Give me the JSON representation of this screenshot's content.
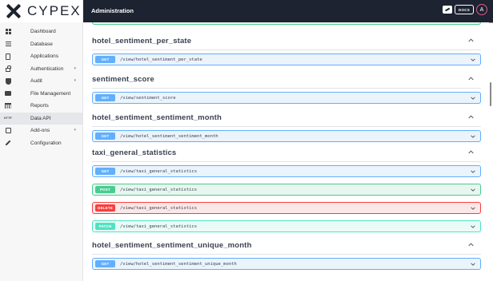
{
  "app": {
    "logo_text": "CYPEX",
    "title": "Administration",
    "docs_label": "DOCS",
    "avatar_initial": "A"
  },
  "sidebar": {
    "items": [
      {
        "label": "Dashboard",
        "icon": "dashboard-icon"
      },
      {
        "label": "Database",
        "icon": "database-icon"
      },
      {
        "label": "Applications",
        "icon": "applications-icon"
      },
      {
        "label": "Authentication",
        "icon": "lock-icon",
        "expandable": true
      },
      {
        "label": "Audit",
        "icon": "shield-icon",
        "expandable": true
      },
      {
        "label": "File Management",
        "icon": "folder-icon"
      },
      {
        "label": "Reports",
        "icon": "table-icon"
      },
      {
        "label": "Data API",
        "icon": "http-icon",
        "active": true,
        "icon_text": "HTTP"
      },
      {
        "label": "Add-ons",
        "icon": "puzzle-icon",
        "expandable": true
      },
      {
        "label": "Configuration",
        "icon": "wrench-icon"
      }
    ]
  },
  "sections": [
    {
      "title": "hotel_sentiment_per_state",
      "operations": [
        {
          "method": "GET",
          "path": "/view/hotel_sentiment_per_state"
        }
      ]
    },
    {
      "title": "sentiment_score",
      "operations": [
        {
          "method": "GET",
          "path": "/view/sentiment_score"
        }
      ]
    },
    {
      "title": "hotel_sentiment_sentiment_month",
      "operations": [
        {
          "method": "GET",
          "path": "/view/hotel_sentiment_sentiment_month"
        }
      ]
    },
    {
      "title": "taxi_general_statistics",
      "operations": [
        {
          "method": "GET",
          "path": "/view/taxi_general_statistics"
        },
        {
          "method": "POST",
          "path": "/view/taxi_general_statistics"
        },
        {
          "method": "DELETE",
          "path": "/view/taxi_general_statistics"
        },
        {
          "method": "PATCH",
          "path": "/view/taxi_general_statistics"
        }
      ]
    },
    {
      "title": "hotel_sentiment_sentiment_unique_month",
      "operations": [
        {
          "method": "GET",
          "path": "/view/hotel_sentiment_sentiment_unique_month"
        }
      ]
    }
  ],
  "colors": {
    "topbar": "#1d2331",
    "get": "#61affe",
    "post": "#49cc90",
    "delete": "#f93e3e",
    "patch": "#50e3c2",
    "avatar_ring": "#e05a8a"
  }
}
